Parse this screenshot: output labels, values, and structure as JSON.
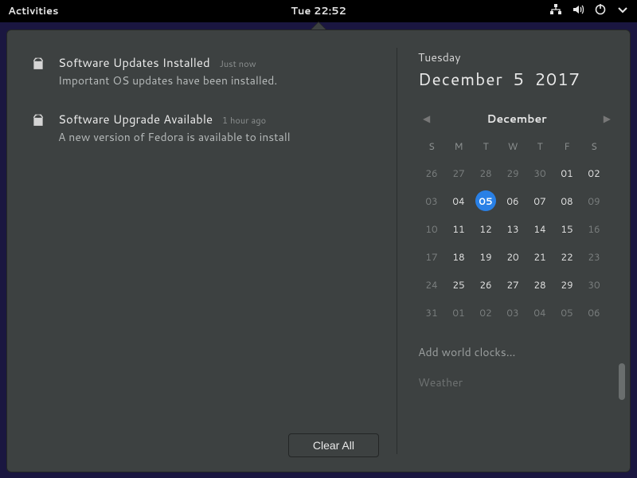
{
  "topbar": {
    "activities": "Activities",
    "clock": "Tue 22:52"
  },
  "notifications": [
    {
      "title": "Software Updates Installed",
      "time": "Just now",
      "msg": "Important OS updates have been installed.",
      "icon": "package-icon"
    },
    {
      "title": "Software Upgrade Available",
      "time": "1 hour ago",
      "msg": "A new version of Fedora is available to install",
      "icon": "package-icon"
    }
  ],
  "clear_all": "Clear All",
  "date": {
    "weekday": "Tuesday",
    "full": "December  5 2017"
  },
  "calendar": {
    "month_label": "December",
    "dow": [
      "S",
      "M",
      "T",
      "W",
      "T",
      "F",
      "S"
    ],
    "today": 5,
    "grid": [
      {
        "n": 26,
        "dim": true
      },
      {
        "n": 27,
        "dim": true
      },
      {
        "n": 28,
        "dim": true
      },
      {
        "n": 29,
        "dim": true
      },
      {
        "n": 30,
        "dim": true
      },
      {
        "n": "01"
      },
      {
        "n": "02"
      },
      {
        "n": "03",
        "dim": true
      },
      {
        "n": "04"
      },
      {
        "n": "05",
        "today": true
      },
      {
        "n": "06"
      },
      {
        "n": "07"
      },
      {
        "n": "08"
      },
      {
        "n": "09",
        "dim": true
      },
      {
        "n": 10,
        "dim": true
      },
      {
        "n": 11
      },
      {
        "n": 12
      },
      {
        "n": 13
      },
      {
        "n": 14
      },
      {
        "n": 15
      },
      {
        "n": 16,
        "dim": true
      },
      {
        "n": 17,
        "dim": true
      },
      {
        "n": 18
      },
      {
        "n": 19
      },
      {
        "n": 20
      },
      {
        "n": 21
      },
      {
        "n": 22
      },
      {
        "n": 23,
        "dim": true
      },
      {
        "n": 24,
        "dim": true
      },
      {
        "n": 25
      },
      {
        "n": 26
      },
      {
        "n": 27
      },
      {
        "n": 28
      },
      {
        "n": 29
      },
      {
        "n": 30,
        "dim": true
      },
      {
        "n": 31,
        "dim": true
      },
      {
        "n": "01",
        "dim": true
      },
      {
        "n": "02",
        "dim": true
      },
      {
        "n": "03",
        "dim": true
      },
      {
        "n": "04",
        "dim": true
      },
      {
        "n": "05",
        "dim": true
      },
      {
        "n": "06",
        "dim": true
      }
    ]
  },
  "world_clocks": "Add world clocks…",
  "weather": "Weather"
}
